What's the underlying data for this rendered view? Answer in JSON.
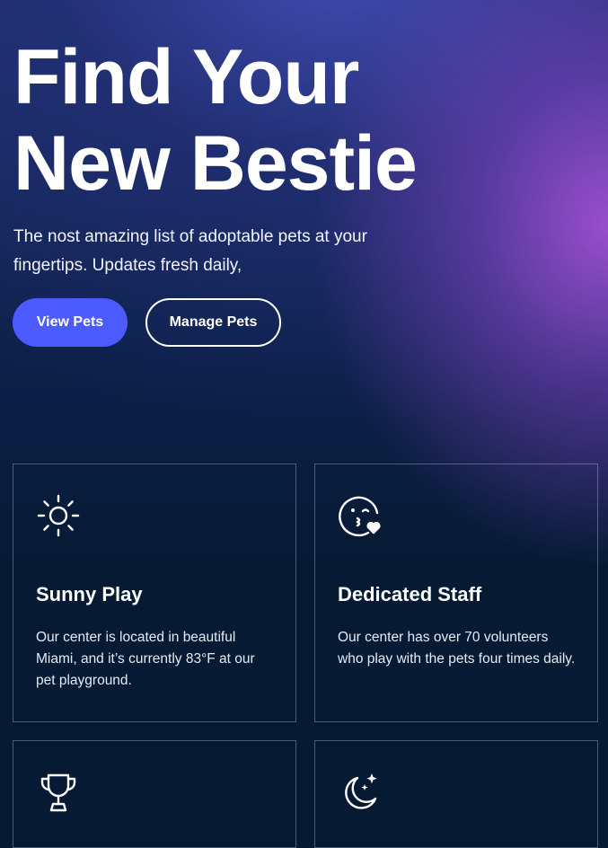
{
  "hero": {
    "headline_line1": "Find Your",
    "headline_line2": "New Bestie",
    "tagline": "The nost amazing list of adoptable pets at your fingertips. Updates fresh daily,",
    "primary_button": "View Pets",
    "secondary_button": "Manage Pets"
  },
  "features": [
    {
      "icon": "sun-icon",
      "title": "Sunny Play",
      "description": "Our center is located in beautiful Miami, and it’s currently 83°F at our pet playground."
    },
    {
      "icon": "kiss-face-icon",
      "title": "Dedicated Staff",
      "description": "Our center has over 70 volunteers who play with the pets four times daily."
    },
    {
      "icon": "trophy-icon",
      "title": "",
      "description": ""
    },
    {
      "icon": "moon-stars-icon",
      "title": "",
      "description": ""
    }
  ],
  "colors": {
    "background": "#061a33",
    "accent_button": "#4c5bff",
    "glow_purple": "#a050d2"
  }
}
